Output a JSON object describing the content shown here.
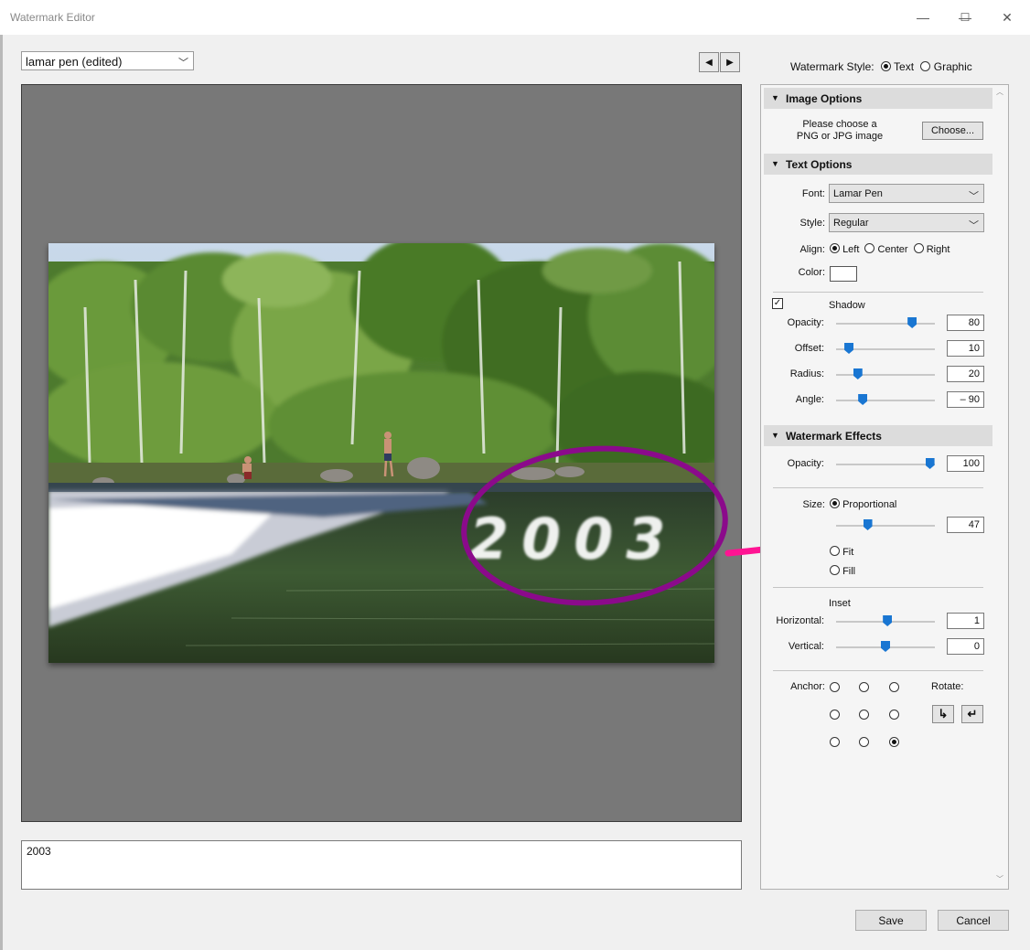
{
  "window": {
    "title": "Watermark Editor",
    "minimize": "—",
    "maximize": "☐",
    "close": "✕"
  },
  "preset": {
    "value": "lamar pen (edited)"
  },
  "nav": {
    "prev": "◀",
    "next": "▶"
  },
  "watermark_style": {
    "label": "Watermark Style:",
    "text": "Text",
    "graphic": "Graphic",
    "selected": "Text"
  },
  "watermark_text": "2003",
  "overlay_text": "2003",
  "image_options": {
    "header": "Image Options",
    "prompt_line1": "Please choose a",
    "prompt_line2": "PNG or JPG image",
    "choose_button": "Choose..."
  },
  "text_options": {
    "header": "Text Options",
    "font_label": "Font:",
    "font_value": "Lamar Pen",
    "style_label": "Style:",
    "style_value": "Regular",
    "align_label": "Align:",
    "align_left": "Left",
    "align_center": "Center",
    "align_right": "Right",
    "align_selected": "Left",
    "color_label": "Color:",
    "color_value": "#ffffff"
  },
  "shadow": {
    "enabled": true,
    "label": "Shadow",
    "opacity_label": "Opacity:",
    "opacity": "80",
    "offset_label": "Offset:",
    "offset": "10",
    "radius_label": "Radius:",
    "radius": "20",
    "angle_label": "Angle:",
    "angle": "– 90"
  },
  "watermark_effects": {
    "header": "Watermark Effects",
    "opacity_label": "Opacity:",
    "opacity": "100",
    "size_label": "Size:",
    "proportional": "Proportional",
    "size_value": "47",
    "fit": "Fit",
    "fill": "Fill",
    "size_mode": "Proportional",
    "inset_label": "Inset",
    "horizontal_label": "Horizontal:",
    "horizontal": "1",
    "vertical_label": "Vertical:",
    "vertical": "0",
    "anchor_label": "Anchor:",
    "anchor_selected": "bottom-right",
    "rotate_label": "Rotate:",
    "rotate_cw": "↳",
    "rotate_ccw": "↵"
  },
  "slider_levels": {
    "shadow_opacity": 0.77,
    "shadow_offset": 0.13,
    "shadow_radius": 0.22,
    "shadow_angle": 0.27,
    "effects_opacity": 0.95,
    "size": 0.32,
    "horizontal": 0.52,
    "vertical": 0.5
  },
  "footer": {
    "save": "Save",
    "cancel": "Cancel"
  },
  "colors": {
    "annotation_circle": "#8b0a8b",
    "annotation_arrow": "#ff1493",
    "slider_thumb": "#1976d2"
  }
}
